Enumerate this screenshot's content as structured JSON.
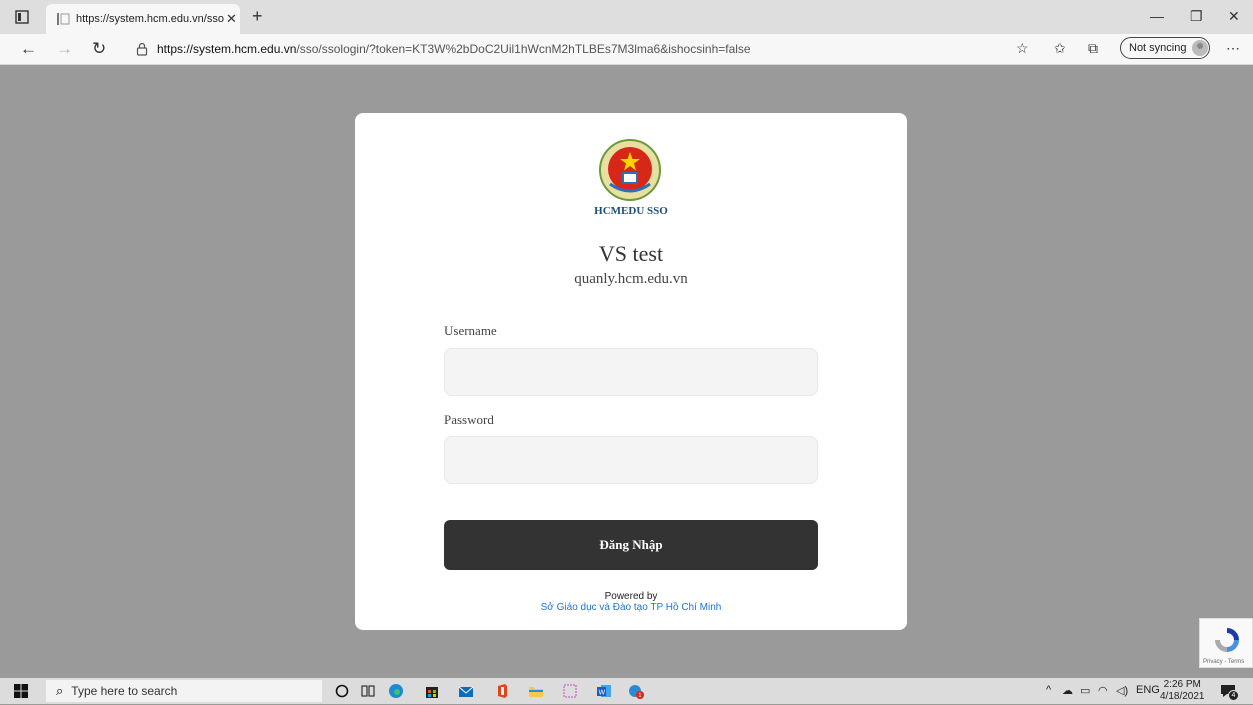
{
  "browser": {
    "tab_title": "https://system.hcm.edu.vn/sso/ss",
    "url_host": "https://system.hcm.edu.vn",
    "url_rest": "/sso/ssologin/?token=KT3W%2bDoC2Uil1hWcnM2hTLBEs7M3lma6&ishocsinh=false",
    "sync_label": "Not syncing"
  },
  "login": {
    "brand": "HCMEDU SSO",
    "app_name": "VS test",
    "app_domain": "quanly.hcm.edu.vn",
    "username_label": "Username",
    "username_value": "",
    "password_label": "Password",
    "password_value": "",
    "submit_label": "Đăng Nhập",
    "powered_by": "Powered by",
    "powered_org": "Sở Giáo dục và Đào tạo TP Hồ Chí Minh"
  },
  "recaptcha": {
    "text": "Privacy - Terms"
  },
  "taskbar": {
    "search_placeholder": "Type here to search",
    "language": "ENG",
    "time": "2:26 PM",
    "date": "4/18/2021",
    "notification_count": "4",
    "badge_count": "1"
  },
  "colors": {
    "page_bg": "#9a9a9a",
    "button_bg": "#333333",
    "link": "#1e73d4"
  }
}
